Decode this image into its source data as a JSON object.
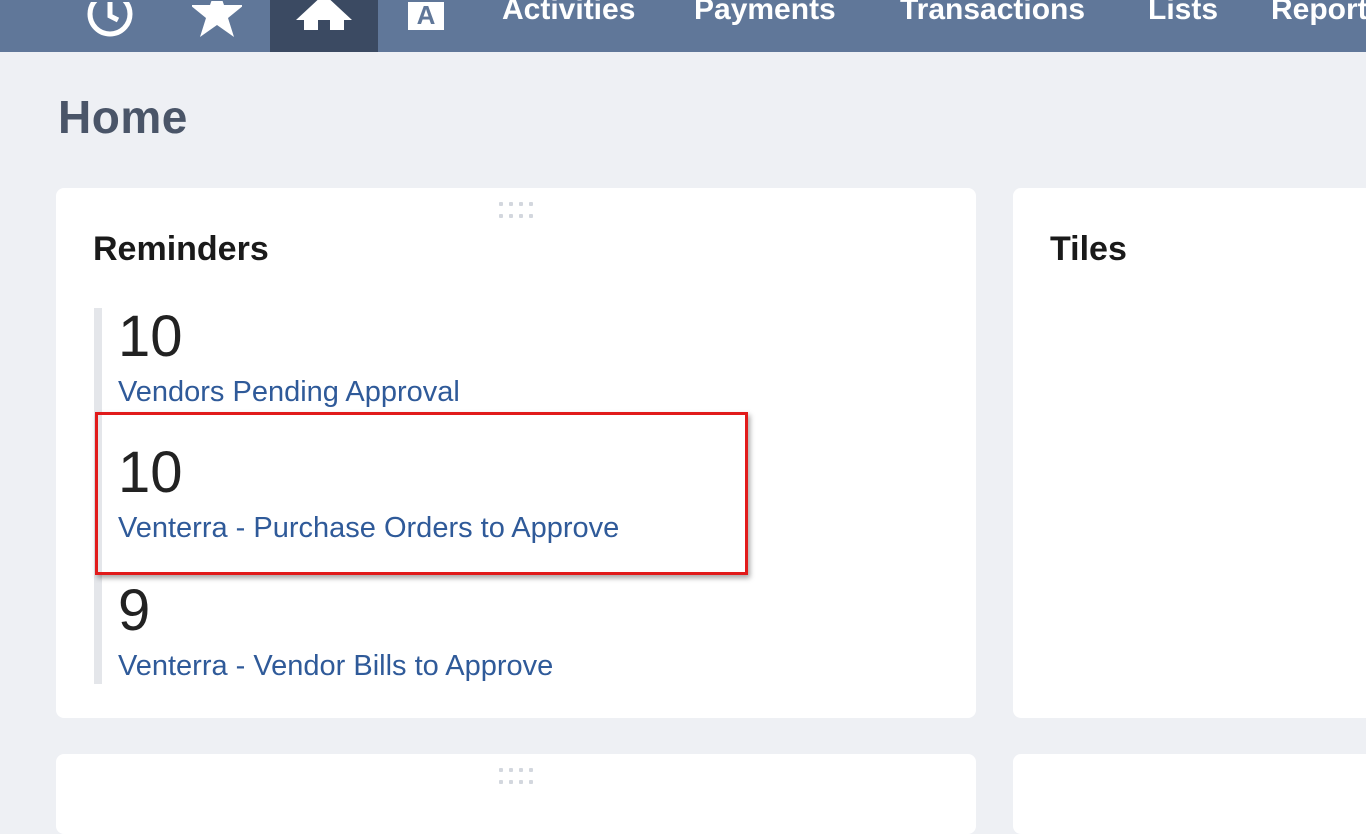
{
  "nav": {
    "icons": [
      "recent-icon",
      "favorites-icon",
      "home-icon",
      "id-card-icon"
    ],
    "links": [
      "Activities",
      "Payments",
      "Transactions",
      "Lists",
      "Reports"
    ]
  },
  "page": {
    "title": "Home"
  },
  "reminders": {
    "title": "Reminders",
    "items": [
      {
        "count": "10",
        "label": "Vendors Pending Approval"
      },
      {
        "count": "10",
        "label": "Venterra - Purchase Orders to Approve"
      },
      {
        "count": "9",
        "label": "Venterra - Vendor Bills to Approve"
      }
    ]
  },
  "tiles": {
    "title": "Tiles"
  },
  "annotation": {
    "highlight_color": "#e11b1b"
  }
}
